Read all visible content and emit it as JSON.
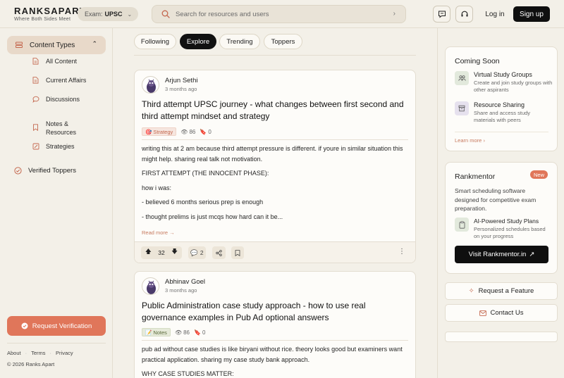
{
  "header": {
    "logo_name": "RANKSAPART",
    "logo_tagline": "Where Both Sides Meet",
    "exam_label": "Exam:",
    "exam_value": "UPSC",
    "search_placeholder": "Search for resources and users",
    "login_label": "Log in",
    "signup_label": "Sign up"
  },
  "sidebar": {
    "content_types_label": "Content Types",
    "items": [
      {
        "label": "All Content",
        "icon": "document-icon"
      },
      {
        "label": "Current Affairs",
        "icon": "document-icon"
      },
      {
        "label": "Discussions",
        "icon": "chat-bubble-icon"
      },
      {
        "label": "Notes & Resources",
        "icon": "bookmark-icon"
      },
      {
        "label": "Strategies",
        "icon": "pencil-icon"
      }
    ],
    "verified_label": "Verified Toppers",
    "request_label": "Request Verification",
    "footer_links": [
      "About",
      "Terms",
      "Privacy"
    ],
    "copyright": "© 2026 Ranks Apart"
  },
  "tabs": [
    {
      "label": "Following",
      "active": false
    },
    {
      "label": "Explore",
      "active": true
    },
    {
      "label": "Trending",
      "active": false
    },
    {
      "label": "Toppers",
      "active": false
    }
  ],
  "posts": [
    {
      "author": "Arjun Sethi",
      "time": "3 months ago",
      "title": "Third attempt UPSC journey - what changes between first second and third attempt mindset and strategy",
      "tag": "Strategy",
      "views": "86",
      "comments_count": "0",
      "body": [
        "writing this at 2 am because third attempt pressure is different. if youre in similar situation this might help. sharing real talk not motivation.",
        "FIRST ATTEMPT (THE INNOCENT PHASE):",
        "how i was:",
        "- believed 6 months serious prep is enough",
        "- thought prelims is just mcqs how hard can it be..."
      ],
      "read_more": "Read more →",
      "votes": "32",
      "comments": "2"
    },
    {
      "author": "Abhinav Goel",
      "time": "3 months ago",
      "title": "Public Administration case study approach - how to use real governance examples in Pub Ad optional answers",
      "tag": "Notes",
      "views": "86",
      "comments_count": "0",
      "body": [
        "pub ad without case studies is like biryani without rice. theory looks good but examiners want practical application. sharing my case study bank approach.",
        "WHY CASE STUDIES MATTER:"
      ]
    }
  ],
  "right": {
    "coming_soon_title": "Coming Soon",
    "features": [
      {
        "title": "Virtual Study Groups",
        "desc": "Create and join study groups with other aspirants"
      },
      {
        "title": "Resource Sharing",
        "desc": "Share and access study materials with peers"
      }
    ],
    "learn_more": "Learn more",
    "rankmentor_title": "Rankmentor",
    "new_badge": "New",
    "rankmentor_desc": "Smart scheduling software designed for competitive exam preparation.",
    "ai_title": "AI-Powered Study Plans",
    "ai_desc": "Personalized schedules based on your progress",
    "visit_label": "Visit Rankmentor.in",
    "request_feature": "Request a Feature",
    "contact_us": "Contact Us"
  }
}
